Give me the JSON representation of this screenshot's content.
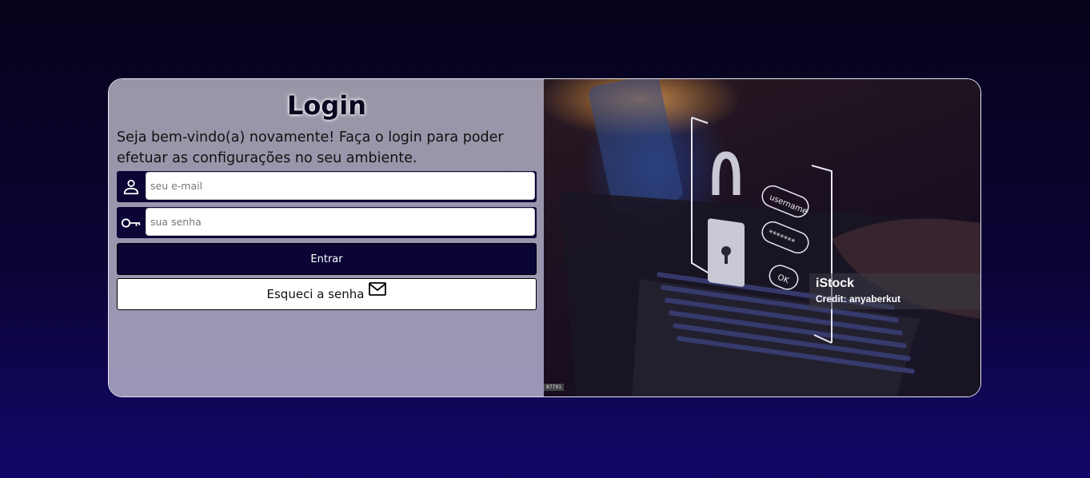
{
  "login": {
    "title": "Login",
    "subtitle": "Seja bem-vindo(a) novamente! Faça o login para poder efetuar as configurações no seu ambiente.",
    "email": {
      "placeholder": "seu e-mail",
      "value": "",
      "icon": "user-icon"
    },
    "password": {
      "placeholder": "sua senha",
      "value": "",
      "icon": "key-icon"
    },
    "submit_label": "Entrar",
    "forgot_label": "Esqueci a senha",
    "forgot_icon": "mail-icon"
  },
  "image": {
    "overlay_labels": [
      "username",
      "*******",
      "OK"
    ],
    "watermark_brand": "iStock",
    "watermark_credit": "Credit: anyaberkut",
    "image_id": "87791"
  },
  "colors": {
    "background_top": "#06021a",
    "background_bottom": "#120668",
    "panel": "#9a95a6",
    "primary_button": "#0a0535",
    "card_border": "#e9e6f5"
  }
}
